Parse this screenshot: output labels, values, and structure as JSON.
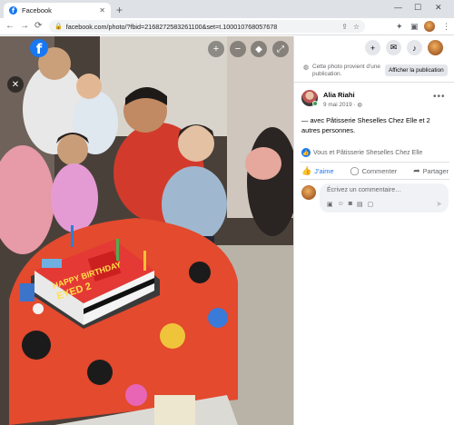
{
  "browser": {
    "tab_title": "Facebook",
    "tab_favicon": "f",
    "new_tab": "+",
    "url": "facebook.com/photo/?fbid=2168272583261100&set=t.100010768057678",
    "window_controls": {
      "minimize": "—",
      "maximize": "☐",
      "close": "✕"
    },
    "nav": {
      "back": "←",
      "forward": "→",
      "reload": "⟳"
    }
  },
  "photo_overlay": {
    "close": "✕",
    "logo": "f",
    "zoom_in": "+",
    "zoom_out": "−",
    "tag": "tag-icon",
    "fullscreen": "⤢"
  },
  "cake_text": {
    "line1": "HAPPY BIRTHDAY",
    "line2": "EYED 2"
  },
  "panel": {
    "notice": "Cette photo provient d’une publication.",
    "show_publication": "Afficher la publication",
    "author": "Alia Riahi",
    "date": "9 mai 2019 · ",
    "post_text": "— avec Pâtisserie Sheselles Chez Elle et 2 autres personnes.",
    "reactions": "Vous et Pâtisserie Sheselles Chez Elle",
    "actions": {
      "like": "J’aime",
      "comment": "Commenter",
      "share": "Partager"
    },
    "comment_placeholder": "Écrivez un commentaire…"
  },
  "colors": {
    "facebook_blue": "#1877f2",
    "panel_bg": "#ffffff",
    "chrome_bg": "#dee1e6"
  }
}
